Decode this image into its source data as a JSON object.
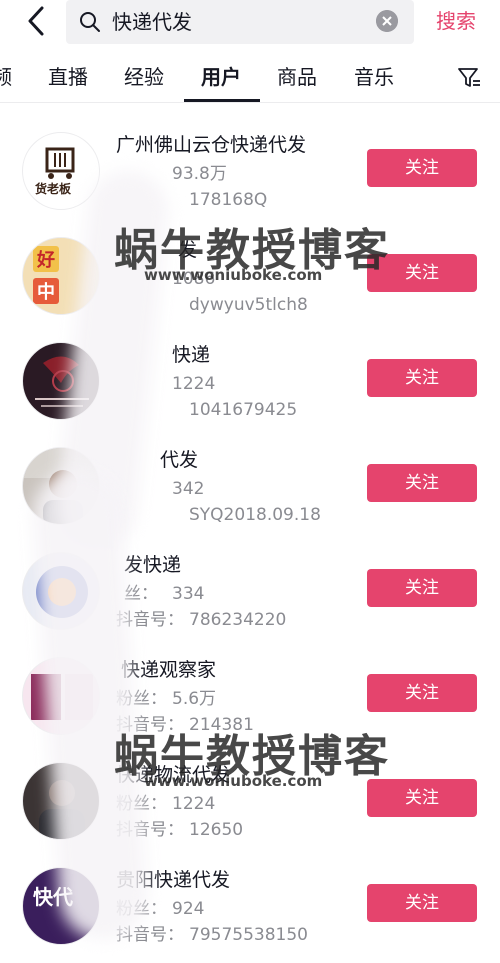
{
  "search": {
    "query": "快递代发",
    "button_label": "搜索"
  },
  "tabs": [
    {
      "label": "频"
    },
    {
      "label": "直播"
    },
    {
      "label": "经验"
    },
    {
      "label": "用户"
    },
    {
      "label": "商品"
    },
    {
      "label": "音乐"
    }
  ],
  "active_tab": "用户",
  "users": [
    {
      "name": "广州佛山云仓快递代发",
      "fans": "93.8万",
      "id": "178168Q",
      "follow": "关注"
    },
    {
      "name": "发",
      "fans": "1086",
      "id": "dywyuv5tlch8",
      "follow": "关注"
    },
    {
      "name": "快递",
      "fans": "1224",
      "id": "1041679425",
      "follow": "关注"
    },
    {
      "name": "代发",
      "fans": "342",
      "id": "SYQ2018.09.18",
      "follow": "关注"
    },
    {
      "name": "发快递",
      "fans_label": "丝：",
      "fans": "334",
      "id_label": "抖音号：",
      "id": "786234220",
      "follow": "关注"
    },
    {
      "name": "快递观察家",
      "fans_label": "粉丝：",
      "fans": "5.6万",
      "id_label": "抖音号：",
      "id": "214381",
      "follow": "关注"
    },
    {
      "name": "快递物流代发",
      "fans_label": "粉丝：",
      "fans": "1224",
      "id_label": "抖音号：",
      "id": "12650",
      "follow": "关注"
    },
    {
      "name": "贵阳快递代发",
      "fans_label": "粉丝：",
      "fans": "924",
      "id_label": "抖音号：",
      "id": "79575538150",
      "follow": "关注"
    }
  ],
  "avatar_texts": {
    "a1": "货老板",
    "a2": "好",
    "a3": "中",
    "a8": "快代"
  },
  "watermark": {
    "text": "蜗牛教授博客",
    "url": "www.woniuboke.com"
  },
  "colors": {
    "accent": "#e5446d",
    "text_primary": "#161823",
    "text_secondary": "#8a8b91"
  }
}
